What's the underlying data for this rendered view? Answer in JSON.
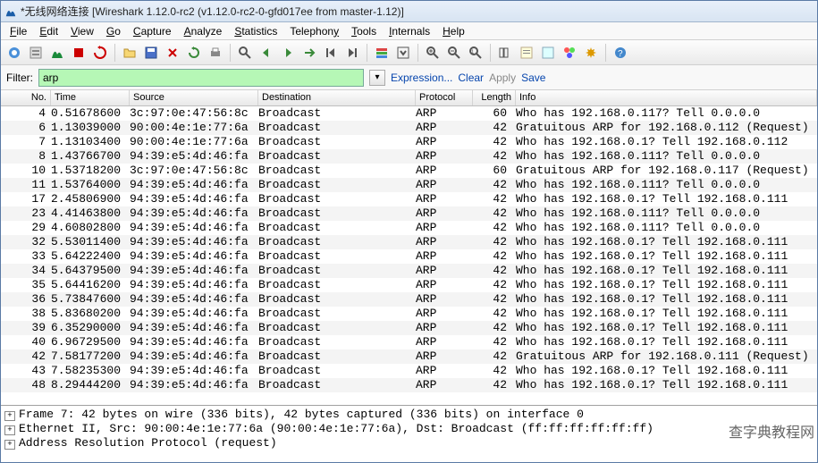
{
  "title": "*无线网络连接   [Wireshark 1.12.0-rc2  (v1.12.0-rc2-0-gfd017ee from master-1.12)]",
  "menu": [
    "File",
    "Edit",
    "View",
    "Go",
    "Capture",
    "Analyze",
    "Statistics",
    "Telephony",
    "Tools",
    "Internals",
    "Help"
  ],
  "filter": {
    "label": "Filter:",
    "value": "arp",
    "expression": "Expression...",
    "clear": "Clear",
    "apply": "Apply",
    "save": "Save"
  },
  "columns": [
    "No.",
    "Time",
    "Source",
    "Destination",
    "Protocol",
    "Length",
    "Info"
  ],
  "packets": [
    {
      "no": 4,
      "time": "0.51678600",
      "src": "3c:97:0e:47:56:8c",
      "dst": "Broadcast",
      "proto": "ARP",
      "len": 60,
      "info": "Who has 192.168.0.117?  Tell 0.0.0.0"
    },
    {
      "no": 6,
      "time": "1.13039000",
      "src": "90:00:4e:1e:77:6a",
      "dst": "Broadcast",
      "proto": "ARP",
      "len": 42,
      "info": "Gratuitous ARP for 192.168.0.112 (Request)"
    },
    {
      "no": 7,
      "time": "1.13103400",
      "src": "90:00:4e:1e:77:6a",
      "dst": "Broadcast",
      "proto": "ARP",
      "len": 42,
      "info": "Who has 192.168.0.1?  Tell 192.168.0.112"
    },
    {
      "no": 8,
      "time": "1.43766700",
      "src": "94:39:e5:4d:46:fa",
      "dst": "Broadcast",
      "proto": "ARP",
      "len": 42,
      "info": "Who has 192.168.0.111?  Tell 0.0.0.0"
    },
    {
      "no": 10,
      "time": "1.53718200",
      "src": "3c:97:0e:47:56:8c",
      "dst": "Broadcast",
      "proto": "ARP",
      "len": 60,
      "info": "Gratuitous ARP for 192.168.0.117 (Request)"
    },
    {
      "no": 11,
      "time": "1.53764000",
      "src": "94:39:e5:4d:46:fa",
      "dst": "Broadcast",
      "proto": "ARP",
      "len": 42,
      "info": "Who has 192.168.0.111?  Tell 0.0.0.0"
    },
    {
      "no": 17,
      "time": "2.45806900",
      "src": "94:39:e5:4d:46:fa",
      "dst": "Broadcast",
      "proto": "ARP",
      "len": 42,
      "info": "Who has 192.168.0.1?  Tell 192.168.0.111"
    },
    {
      "no": 23,
      "time": "4.41463800",
      "src": "94:39:e5:4d:46:fa",
      "dst": "Broadcast",
      "proto": "ARP",
      "len": 42,
      "info": "Who has 192.168.0.111?  Tell 0.0.0.0"
    },
    {
      "no": 29,
      "time": "4.60802800",
      "src": "94:39:e5:4d:46:fa",
      "dst": "Broadcast",
      "proto": "ARP",
      "len": 42,
      "info": "Who has 192.168.0.111?  Tell 0.0.0.0"
    },
    {
      "no": 32,
      "time": "5.53011400",
      "src": "94:39:e5:4d:46:fa",
      "dst": "Broadcast",
      "proto": "ARP",
      "len": 42,
      "info": "Who has 192.168.0.1?  Tell 192.168.0.111"
    },
    {
      "no": 33,
      "time": "5.64222400",
      "src": "94:39:e5:4d:46:fa",
      "dst": "Broadcast",
      "proto": "ARP",
      "len": 42,
      "info": "Who has 192.168.0.1?  Tell 192.168.0.111"
    },
    {
      "no": 34,
      "time": "5.64379500",
      "src": "94:39:e5:4d:46:fa",
      "dst": "Broadcast",
      "proto": "ARP",
      "len": 42,
      "info": "Who has 192.168.0.1?  Tell 192.168.0.111"
    },
    {
      "no": 35,
      "time": "5.64416200",
      "src": "94:39:e5:4d:46:fa",
      "dst": "Broadcast",
      "proto": "ARP",
      "len": 42,
      "info": "Who has 192.168.0.1?  Tell 192.168.0.111"
    },
    {
      "no": 36,
      "time": "5.73847600",
      "src": "94:39:e5:4d:46:fa",
      "dst": "Broadcast",
      "proto": "ARP",
      "len": 42,
      "info": "Who has 192.168.0.1?  Tell 192.168.0.111"
    },
    {
      "no": 38,
      "time": "5.83680200",
      "src": "94:39:e5:4d:46:fa",
      "dst": "Broadcast",
      "proto": "ARP",
      "len": 42,
      "info": "Who has 192.168.0.1?  Tell 192.168.0.111"
    },
    {
      "no": 39,
      "time": "6.35290000",
      "src": "94:39:e5:4d:46:fa",
      "dst": "Broadcast",
      "proto": "ARP",
      "len": 42,
      "info": "Who has 192.168.0.1?  Tell 192.168.0.111"
    },
    {
      "no": 40,
      "time": "6.96729500",
      "src": "94:39:e5:4d:46:fa",
      "dst": "Broadcast",
      "proto": "ARP",
      "len": 42,
      "info": "Who has 192.168.0.1?  Tell 192.168.0.111"
    },
    {
      "no": 42,
      "time": "7.58177200",
      "src": "94:39:e5:4d:46:fa",
      "dst": "Broadcast",
      "proto": "ARP",
      "len": 42,
      "info": "Gratuitous ARP for 192.168.0.111 (Request)"
    },
    {
      "no": 43,
      "time": "7.58235300",
      "src": "94:39:e5:4d:46:fa",
      "dst": "Broadcast",
      "proto": "ARP",
      "len": 42,
      "info": "Who has 192.168.0.1?  Tell 192.168.0.111"
    },
    {
      "no": 48,
      "time": "8.29444200",
      "src": "94:39:e5:4d:46:fa",
      "dst": "Broadcast",
      "proto": "ARP",
      "len": 42,
      "info": "Who has 192.168.0.1?  Tell 192.168.0.111"
    }
  ],
  "details": [
    "Frame 7: 42 bytes on wire (336 bits), 42 bytes captured (336 bits) on interface 0",
    "Ethernet II, Src: 90:00:4e:1e:77:6a (90:00:4e:1e:77:6a), Dst: Broadcast (ff:ff:ff:ff:ff:ff)",
    "Address Resolution Protocol (request)"
  ],
  "watermark": "查字典教程网"
}
